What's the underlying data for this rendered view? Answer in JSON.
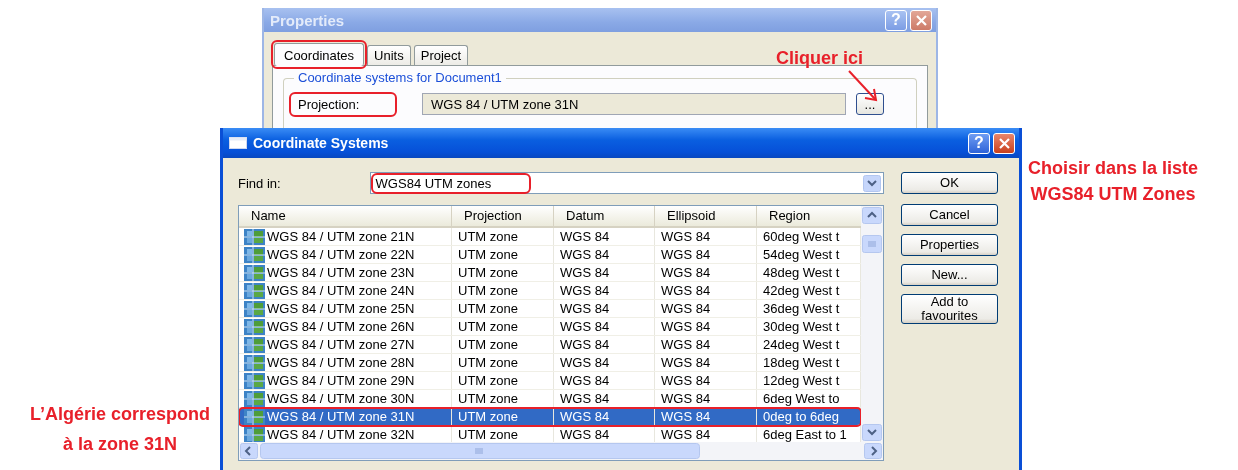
{
  "properties_window": {
    "title": "Properties",
    "help_button": "?",
    "tabs": [
      {
        "label": "Coordinates",
        "selected": true,
        "highlighted": true
      },
      {
        "label": "Units",
        "selected": false,
        "highlighted": false
      },
      {
        "label": "Project",
        "selected": false,
        "highlighted": false
      }
    ],
    "group_title": "Coordinate systems for Document1",
    "projection_label": "Projection:",
    "projection_label_highlighted": true,
    "projection_value": "WGS 84 / UTM zone 31N",
    "browse_button": "..."
  },
  "coordinate_systems_window": {
    "title": "Coordinate Systems",
    "help_button": "?",
    "find_in_label": "Find in:",
    "find_in_value": "WGS84 UTM zones",
    "find_in_highlighted": true,
    "columns": [
      "Name",
      "Projection",
      "Datum",
      "Ellipsoid",
      "Region"
    ],
    "rows": [
      {
        "cells": [
          "WGS 84 / UTM zone 21N",
          "UTM zone",
          "WGS 84",
          "WGS 84",
          "60deg West t"
        ],
        "selected": false,
        "highlighted": false
      },
      {
        "cells": [
          "WGS 84 / UTM zone 22N",
          "UTM zone",
          "WGS 84",
          "WGS 84",
          "54deg West t"
        ],
        "selected": false,
        "highlighted": false
      },
      {
        "cells": [
          "WGS 84 / UTM zone 23N",
          "UTM zone",
          "WGS 84",
          "WGS 84",
          "48deg West t"
        ],
        "selected": false,
        "highlighted": false
      },
      {
        "cells": [
          "WGS 84 / UTM zone 24N",
          "UTM zone",
          "WGS 84",
          "WGS 84",
          "42deg West t"
        ],
        "selected": false,
        "highlighted": false
      },
      {
        "cells": [
          "WGS 84 / UTM zone 25N",
          "UTM zone",
          "WGS 84",
          "WGS 84",
          "36deg West t"
        ],
        "selected": false,
        "highlighted": false
      },
      {
        "cells": [
          "WGS 84 / UTM zone 26N",
          "UTM zone",
          "WGS 84",
          "WGS 84",
          "30deg West t"
        ],
        "selected": false,
        "highlighted": false
      },
      {
        "cells": [
          "WGS 84 / UTM zone 27N",
          "UTM zone",
          "WGS 84",
          "WGS 84",
          "24deg West t"
        ],
        "selected": false,
        "highlighted": false
      },
      {
        "cells": [
          "WGS 84 / UTM zone 28N",
          "UTM zone",
          "WGS 84",
          "WGS 84",
          "18deg West t"
        ],
        "selected": false,
        "highlighted": false
      },
      {
        "cells": [
          "WGS 84 / UTM zone 29N",
          "UTM zone",
          "WGS 84",
          "WGS 84",
          "12deg West t"
        ],
        "selected": false,
        "highlighted": false
      },
      {
        "cells": [
          "WGS 84 / UTM zone 30N",
          "UTM zone",
          "WGS 84",
          "WGS 84",
          "6deg West to"
        ],
        "selected": false,
        "highlighted": false
      },
      {
        "cells": [
          "WGS 84 / UTM zone 31N",
          "UTM zone",
          "WGS 84",
          "WGS 84",
          "0deg to 6deg"
        ],
        "selected": true,
        "highlighted": true
      },
      {
        "cells": [
          "WGS 84 / UTM zone 32N",
          "UTM zone",
          "WGS 84",
          "WGS 84",
          "6deg East to 1"
        ],
        "selected": false,
        "highlighted": false
      }
    ],
    "buttons": [
      "OK",
      "Cancel",
      "Properties",
      "New...",
      "Add to favourites"
    ]
  },
  "annotations": [
    {
      "kind": "click",
      "lines": [
        "Cliquer ici"
      ]
    },
    {
      "kind": "choose",
      "lines": [
        "Choisir dans la liste",
        "WGS84 UTM Zones"
      ]
    },
    {
      "kind": "zone",
      "lines": [
        "L’Algérie correspond",
        "à la zone 31N"
      ]
    }
  ]
}
